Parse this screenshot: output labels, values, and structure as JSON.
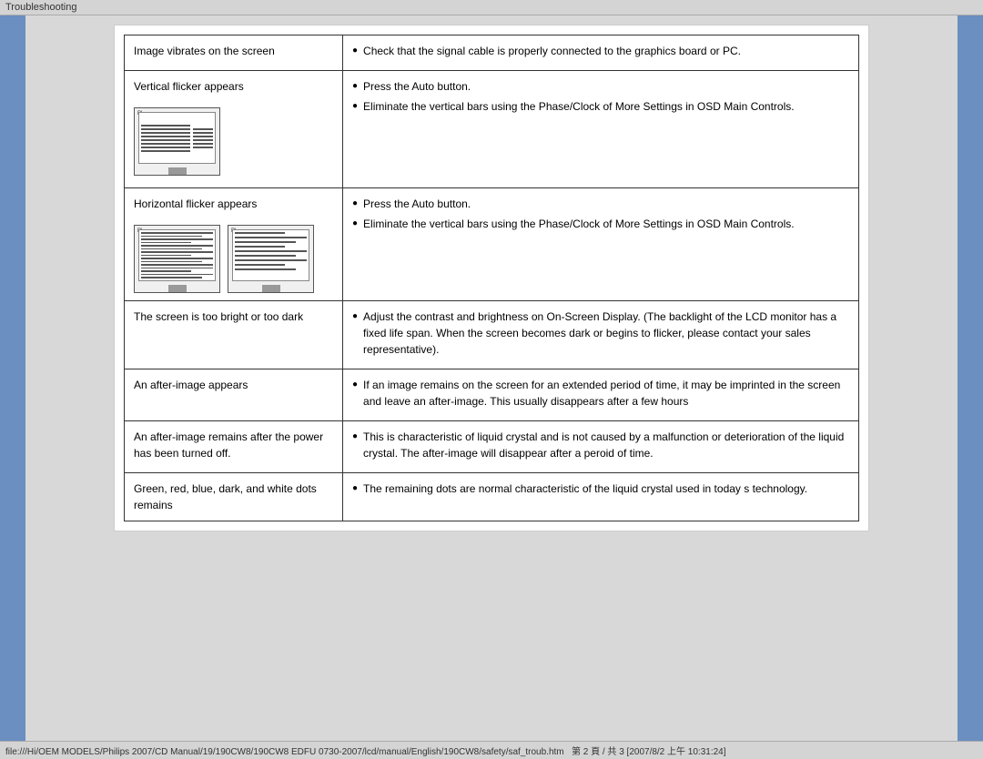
{
  "topbar": {
    "label": "Troubleshooting"
  },
  "bottombar": {
    "path": "file:///Hi/OEM MODELS/Philips 2007/CD Manual/19/190CW8/190CW8 EDFU 0730-2007/lcd/manual/English/190CW8/safety/saf_troub.htm",
    "pageinfo": "第 2 頁 / 共 3 [2007/8/2 上午 10:31:24]"
  },
  "table": {
    "rows": [
      {
        "id": "row-image-vibrates",
        "left": "Image vibrates on the screen",
        "right_bullets": [
          "Check that the signal cable is properly connected to the graphics board or PC."
        ]
      },
      {
        "id": "row-vertical-flicker",
        "left_title": "Vertical flicker appears",
        "has_image": true,
        "image_type": "vertical",
        "right_bullets": [
          "Press the Auto button.",
          "Eliminate the vertical bars using the Phase/Clock of More Settings in OSD Main Controls."
        ]
      },
      {
        "id": "row-horizontal-flicker",
        "left_title": "Horizontal flicker appears",
        "has_image": true,
        "image_type": "horizontal",
        "right_bullets": [
          "Press the Auto button.",
          "Eliminate the vertical bars using the Phase/Clock of More Settings in OSD Main Controls."
        ]
      },
      {
        "id": "row-too-bright-dark",
        "left": "The screen is too bright or too dark",
        "right_bullets": [
          "Adjust the contrast and brightness on On-Screen Display. (The backlight of the LCD monitor has a fixed life span. When the screen becomes dark or begins to flicker, please contact your sales representative)."
        ]
      },
      {
        "id": "row-after-image",
        "left": "An after-image appears",
        "right_bullets": [
          "If an image remains on the screen for an extended period of time, it may be imprinted in the screen and leave an after-image. This usually disappears after a few hours"
        ]
      },
      {
        "id": "row-after-image-power",
        "left": "An after-image remains after the power has been turned off.",
        "right_bullets": [
          "This is characteristic of liquid crystal and is not caused by a malfunction or deterioration of the liquid crystal. The after-image will disappear after a peroid of time."
        ]
      },
      {
        "id": "row-green-red-blue",
        "left": "Green, red, blue, dark, and white dots remains",
        "right_bullets": [
          "The remaining dots are normal characteristic of the liquid crystal used in today s technology."
        ]
      }
    ]
  }
}
